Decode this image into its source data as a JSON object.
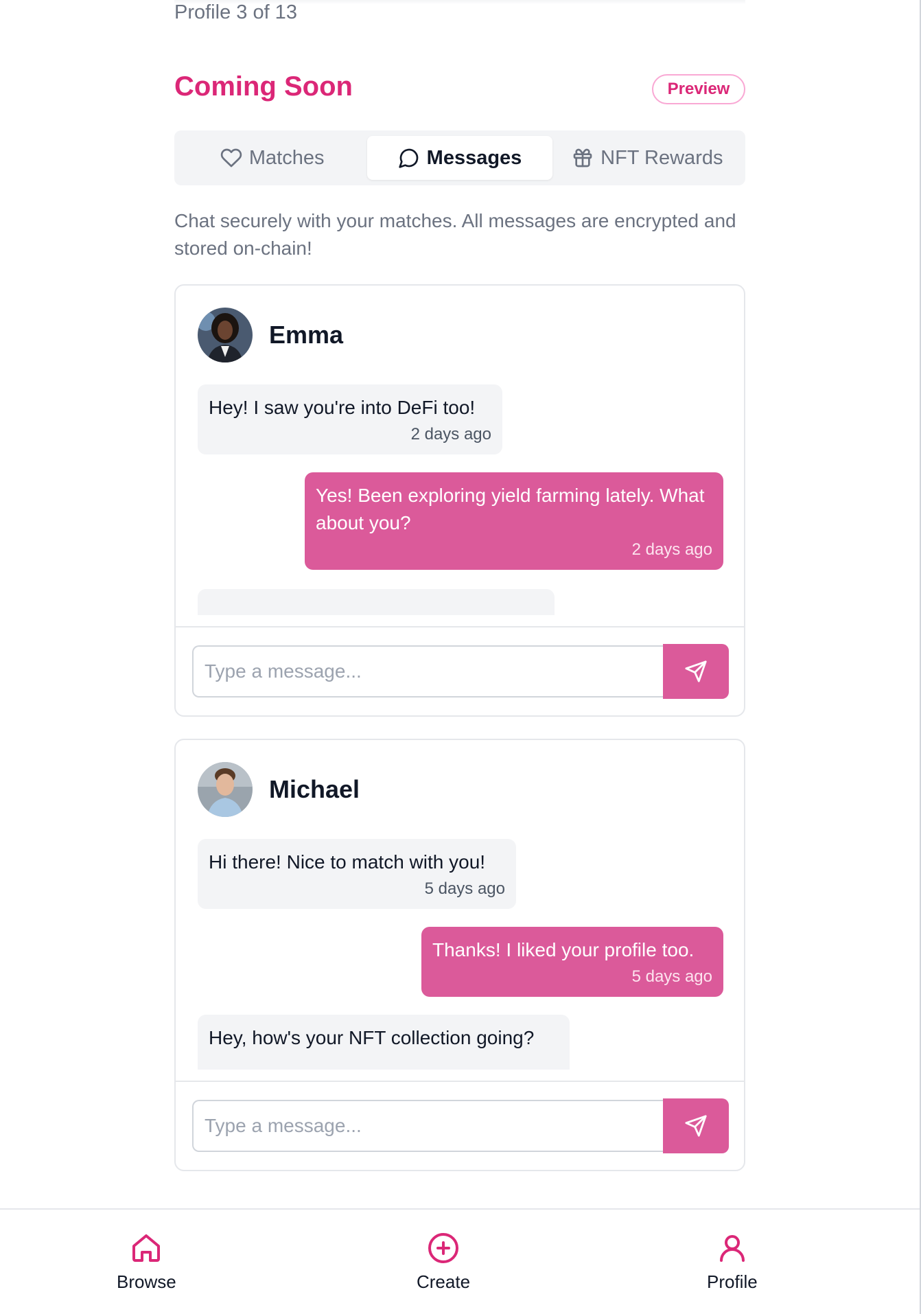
{
  "header": {
    "profile_counter": "Profile 3 of 13",
    "section_title": "Coming Soon",
    "preview_badge": "Preview"
  },
  "tabs": [
    {
      "label": "Matches",
      "icon": "heart-icon",
      "active": false
    },
    {
      "label": "Messages",
      "icon": "message-circle-icon",
      "active": true
    },
    {
      "label": "NFT Rewards",
      "icon": "gift-icon",
      "active": false
    }
  ],
  "intro_text": "Chat securely with your matches. All messages are encrypted and stored on-chain!",
  "chats": [
    {
      "name": "Emma",
      "messages": [
        {
          "direction": "in",
          "text": "Hey! I saw you're into DeFi too!",
          "time": "2 days ago"
        },
        {
          "direction": "out",
          "text": "Yes! Been exploring yield farming lately. What about you?",
          "time": "2 days ago"
        }
      ],
      "input_placeholder": "Type a message..."
    },
    {
      "name": "Michael",
      "messages": [
        {
          "direction": "in",
          "text": "Hi there! Nice to match with you!",
          "time": "5 days ago"
        },
        {
          "direction": "out",
          "text": "Thanks! I liked your profile too.",
          "time": "5 days ago"
        },
        {
          "direction": "in",
          "text": "Hey, how's your NFT collection going?",
          "time": ""
        }
      ],
      "input_placeholder": "Type a message..."
    }
  ],
  "bottom_nav": [
    {
      "label": "Browse",
      "icon": "home-icon"
    },
    {
      "label": "Create",
      "icon": "plus-circle-icon"
    },
    {
      "label": "Profile",
      "icon": "user-icon"
    }
  ],
  "colors": {
    "accent": "#db2777",
    "bubble_out": "#db5a9a",
    "bubble_in": "#f3f4f6"
  }
}
